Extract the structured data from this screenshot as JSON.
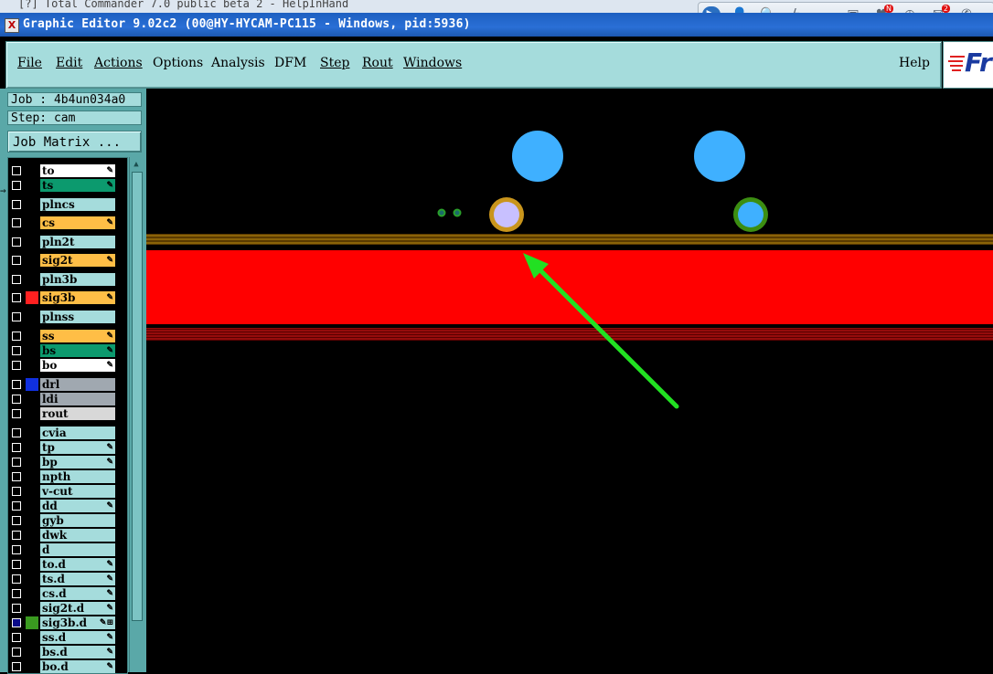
{
  "background_window": {
    "title": "[?] Total Commander 7.0 public beta 2 - HelpInHand"
  },
  "window": {
    "title": "Graphic Editor 9.02c2 (00@HY-HYCAM-PC115 - Windows, pid:5936)",
    "icon": "x-icon"
  },
  "tray": {
    "icons": [
      "media-icon",
      "user-icon",
      "search-icon",
      "lightning-icon",
      "cloud-icon",
      "gallery-icon",
      "heart-icon",
      "clock-icon",
      "mail-icon",
      "settings-icon"
    ],
    "heart_badge": "N",
    "mail_badge": "2"
  },
  "menubar": {
    "items": [
      "File",
      "Edit",
      "Actions",
      "Options",
      "Analysis",
      "DFM",
      "Step",
      "Rout",
      "Windows"
    ],
    "help": "Help",
    "logo": "Fr"
  },
  "panel": {
    "job": "Job : 4b4un034a0",
    "step": "Step: cam",
    "job_matrix": "Job Matrix ..."
  },
  "layers": [
    {
      "name": "to",
      "color": "#ffffff",
      "swatch": "#000000",
      "edit": true
    },
    {
      "name": "ts",
      "color": "#0c9a6e",
      "swatch": "#000000",
      "edit": true
    },
    {
      "name": "plncs",
      "color": "#a5dcdc",
      "swatch": "#000000",
      "edit": false
    },
    {
      "name": "cs",
      "color": "#ffbe46",
      "swatch": "#000000",
      "edit": true
    },
    {
      "name": "pln2t",
      "color": "#a5dcdc",
      "swatch": "#000000",
      "edit": false
    },
    {
      "name": "sig2t",
      "color": "#ffbe46",
      "swatch": "#000000",
      "edit": true
    },
    {
      "name": "pln3b",
      "color": "#a5dcdc",
      "swatch": "#000000",
      "edit": false
    },
    {
      "name": "sig3b",
      "color": "#ffbe46",
      "swatch": "#ff2020",
      "edit": true
    },
    {
      "name": "plnss",
      "color": "#a5dcdc",
      "swatch": "#000000",
      "edit": false
    },
    {
      "name": "ss",
      "color": "#ffbe46",
      "swatch": "#000000",
      "edit": true
    },
    {
      "name": "bs",
      "color": "#0c9a6e",
      "swatch": "#000000",
      "edit": true
    },
    {
      "name": "bo",
      "color": "#ffffff",
      "swatch": "#000000",
      "edit": true
    },
    {
      "name": "drl",
      "color": "#a0a8b0",
      "swatch": "#1030e0",
      "edit": false
    },
    {
      "name": "ldi",
      "color": "#a0a8b0",
      "swatch": "#000000",
      "edit": false
    },
    {
      "name": "rout",
      "color": "#d8d8d8",
      "swatch": "#000000",
      "edit": false
    },
    {
      "name": "cvia",
      "color": "#a5dcdc",
      "swatch": "#000000",
      "edit": false
    },
    {
      "name": "tp",
      "color": "#a5dcdc",
      "swatch": "#000000",
      "edit": true
    },
    {
      "name": "bp",
      "color": "#a5dcdc",
      "swatch": "#000000",
      "edit": true
    },
    {
      "name": "npth",
      "color": "#a5dcdc",
      "swatch": "#000000",
      "edit": false
    },
    {
      "name": "v-cut",
      "color": "#a5dcdc",
      "swatch": "#000000",
      "edit": false
    },
    {
      "name": "dd",
      "color": "#a5dcdc",
      "swatch": "#000000",
      "edit": true
    },
    {
      "name": "gyb",
      "color": "#a5dcdc",
      "swatch": "#000000",
      "edit": false
    },
    {
      "name": "dwk",
      "color": "#a5dcdc",
      "swatch": "#000000",
      "edit": false
    },
    {
      "name": "d",
      "color": "#a5dcdc",
      "swatch": "#000000",
      "edit": false
    },
    {
      "name": "to.d",
      "color": "#a5dcdc",
      "swatch": "#000000",
      "edit": true
    },
    {
      "name": "ts.d",
      "color": "#a5dcdc",
      "swatch": "#000000",
      "edit": true
    },
    {
      "name": "cs.d",
      "color": "#a5dcdc",
      "swatch": "#000000",
      "edit": true
    },
    {
      "name": "sig2t.d",
      "color": "#a5dcdc",
      "swatch": "#000000",
      "edit": true
    },
    {
      "name": "sig3b.d",
      "color": "#a5dcdc",
      "swatch": "#3a9a20",
      "edit": true,
      "selected": true
    },
    {
      "name": "ss.d",
      "color": "#a5dcdc",
      "swatch": "#000000",
      "edit": true
    },
    {
      "name": "bs.d",
      "color": "#a5dcdc",
      "swatch": "#000000",
      "edit": true
    },
    {
      "name": "bo.d",
      "color": "#a5dcdc",
      "swatch": "#000000",
      "edit": true
    }
  ],
  "canvas_colors": {
    "pad_blue": "#3fb0ff",
    "ring_gold": "#c9951c",
    "ring_green": "#3c8e12",
    "inner_lavender": "#c8c0ff",
    "copper_band": "#ff0000",
    "arrow": "#22e022"
  }
}
